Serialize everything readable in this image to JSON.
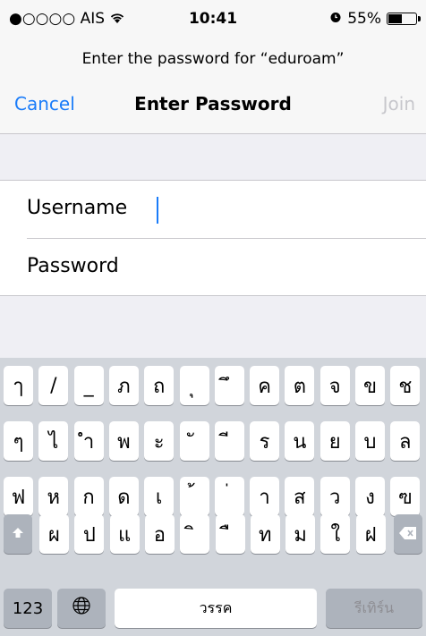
{
  "status": {
    "carrier": "●○○○○ AIS",
    "time": "10:41",
    "battery_pct": "55%",
    "battery_level": 0.55
  },
  "header": {
    "prompt": "Enter the password for “eduroam”",
    "cancel": "Cancel",
    "title": "Enter Password",
    "join": "Join"
  },
  "form": {
    "username_label": "Username",
    "password_label": "Password"
  },
  "keyboard": {
    "row1": [
      "ๅ",
      "/",
      "_",
      "ภ",
      "ถ",
      "ุ",
      "ึ",
      "ค",
      "ต",
      "จ",
      "ข",
      "ช"
    ],
    "row2": [
      "ๆ",
      "ไ",
      "ำ",
      "พ",
      "ะ",
      "ั",
      "ี",
      "ร",
      "น",
      "ย",
      "บ",
      "ล"
    ],
    "row3": [
      "ฟ",
      "ห",
      "ก",
      "ด",
      "เ",
      "้",
      "่",
      "า",
      "ส",
      "ว",
      "ง",
      "ฃ"
    ],
    "row4": [
      "ผ",
      "ป",
      "แ",
      "อ",
      "ิ",
      "ื",
      "ท",
      "ม",
      "ใ",
      "ฝ"
    ],
    "numbers_key": "123",
    "space_key": "วรรค",
    "return_key": "รีเทิร์น"
  }
}
